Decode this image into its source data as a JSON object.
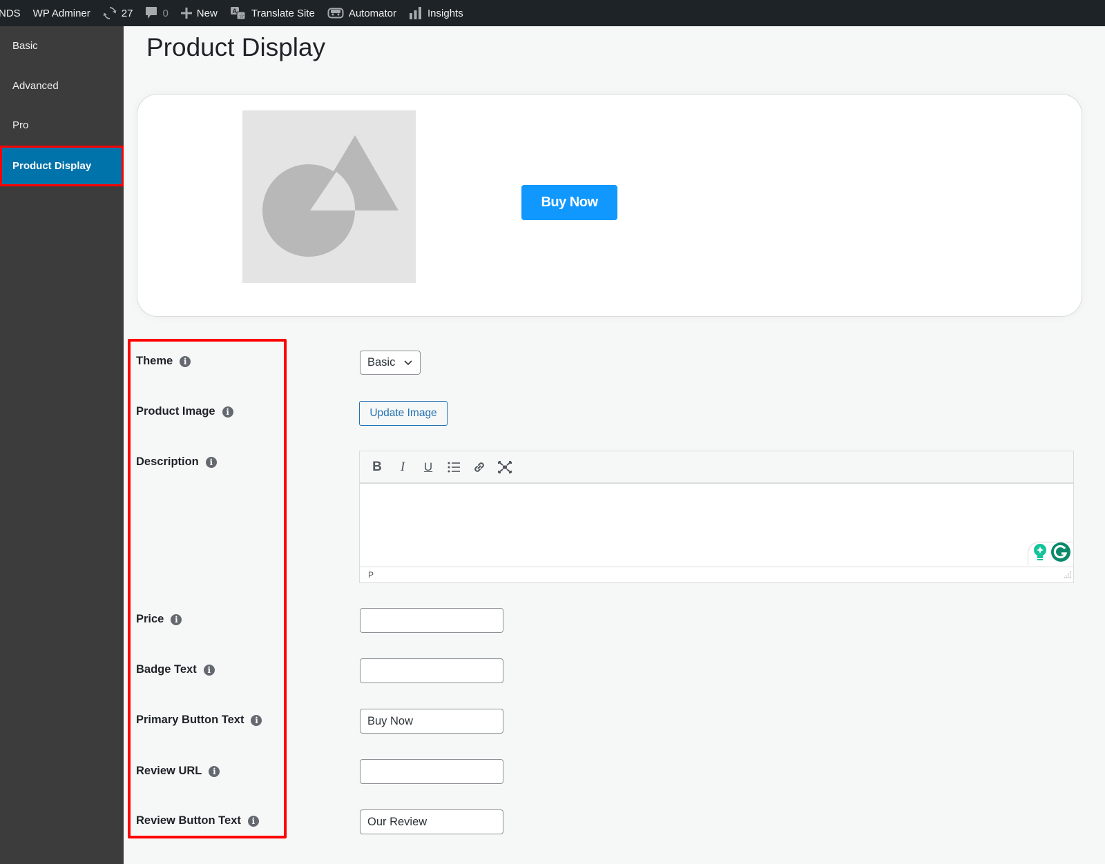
{
  "adminbar": {
    "site_name_partial": "NDS",
    "items": [
      {
        "icon": "none",
        "label": "WP Adminer"
      },
      {
        "icon": "updates-icon",
        "label": "27"
      },
      {
        "icon": "comment-icon",
        "label": "0"
      },
      {
        "icon": "plus-icon",
        "label": "New"
      },
      {
        "icon": "translate-icon",
        "label": "Translate Site"
      },
      {
        "icon": "automator-icon",
        "label": "Automator"
      },
      {
        "icon": "bar-chart-icon",
        "label": "Insights"
      }
    ]
  },
  "sidebar": {
    "items": [
      {
        "label": "Basic",
        "active": false
      },
      {
        "label": "Advanced",
        "active": false
      },
      {
        "label": "Pro",
        "active": false
      },
      {
        "label": "Product Display",
        "active": true
      }
    ]
  },
  "page": {
    "title": "Product Display"
  },
  "preview": {
    "image_alt": "placeholder-image",
    "button_label": "Buy Now",
    "button_color": "#1198fe"
  },
  "form": {
    "fields": [
      {
        "label": "Theme",
        "type": "select",
        "value": "Basic"
      },
      {
        "label": "Product Image",
        "type": "button",
        "value": "Update Image"
      },
      {
        "label": "Description",
        "type": "editor",
        "value": ""
      },
      {
        "label": "Price",
        "type": "text",
        "value": ""
      },
      {
        "label": "Badge Text",
        "type": "text",
        "value": ""
      },
      {
        "label": "Primary Button Text",
        "type": "text",
        "value": "Buy Now"
      },
      {
        "label": "Review URL",
        "type": "text",
        "value": ""
      },
      {
        "label": "Review Button Text",
        "type": "text",
        "value": "Our Review"
      }
    ],
    "editor": {
      "toolbar": [
        "bold-icon",
        "italic-icon",
        "underline-icon",
        "bullet-list-icon",
        "link-icon",
        "fullscreen-icon"
      ],
      "toolbar_glyphs": [
        "B",
        "I",
        "U"
      ],
      "status_path": "P"
    }
  },
  "colors": {
    "admin_bar": "#1d2327",
    "sidebar": "#3c3c3c",
    "active_item": "#0073aa",
    "highlight": "#ff0000",
    "link": "#2271b1"
  }
}
